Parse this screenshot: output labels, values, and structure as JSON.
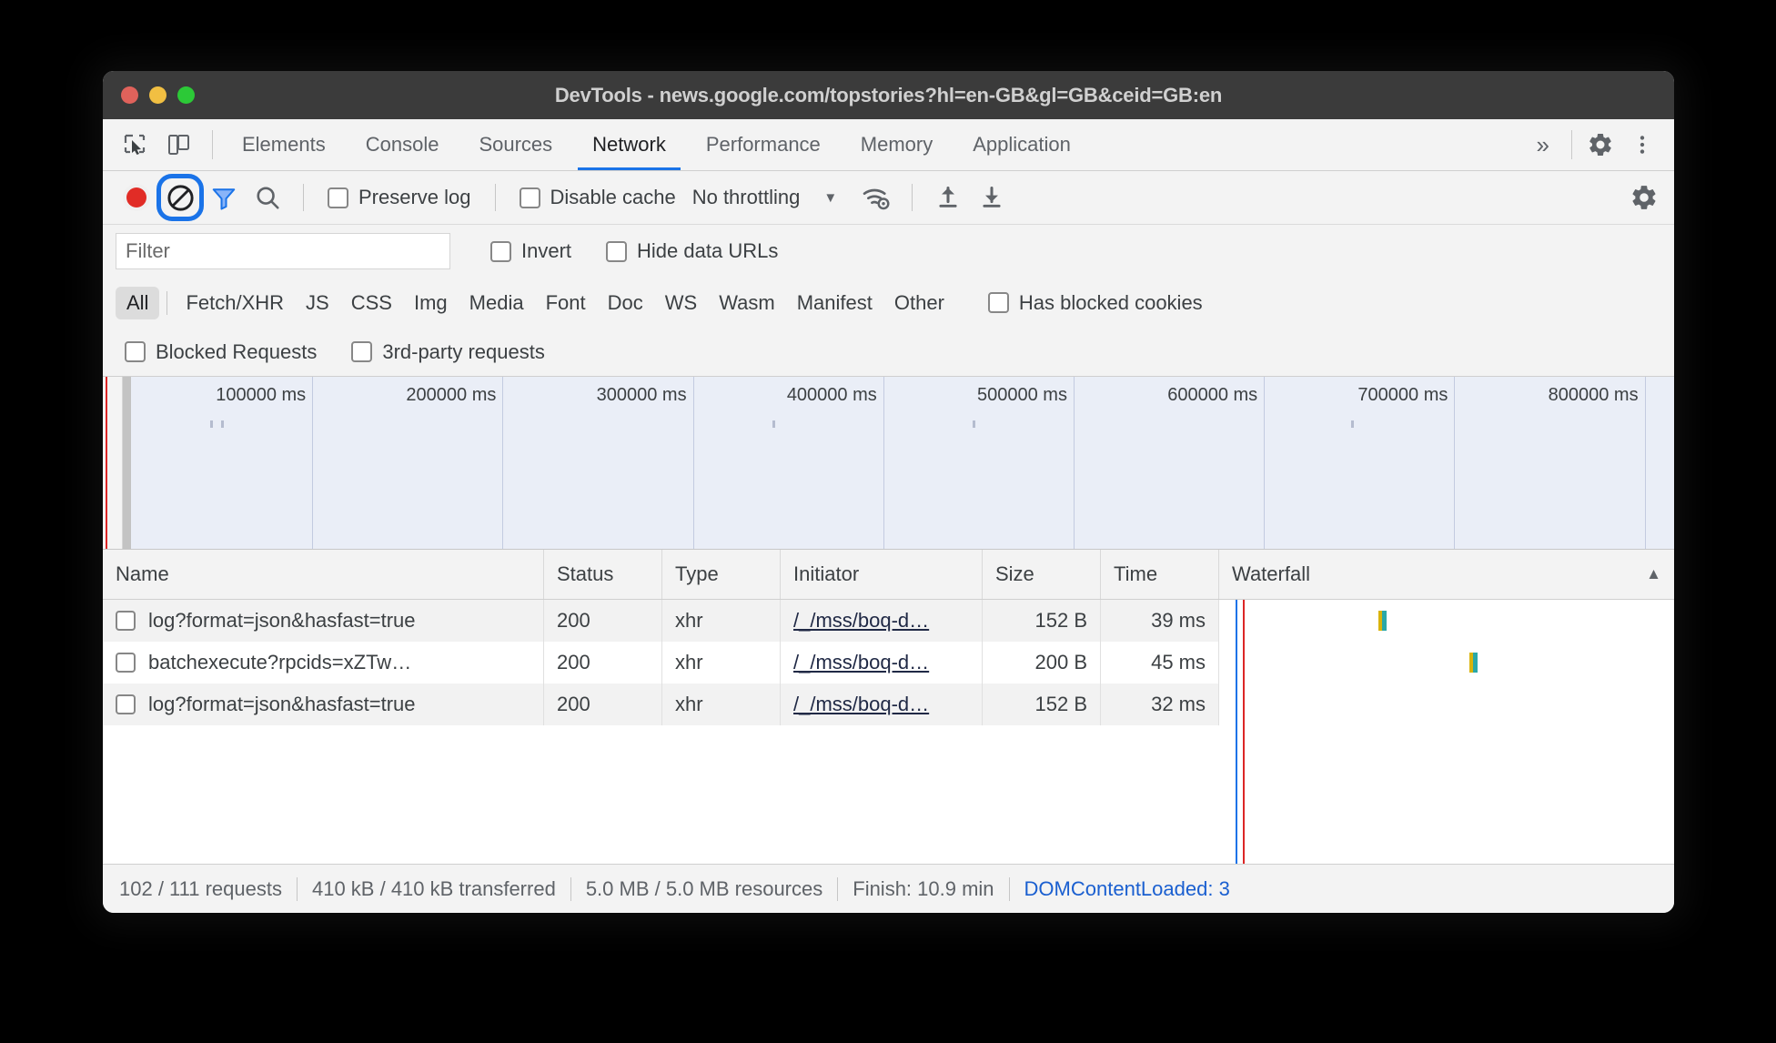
{
  "window": {
    "title": "DevTools - news.google.com/topstories?hl=en-GB&gl=GB&ceid=GB:en"
  },
  "tabstrip": {
    "tabs": [
      {
        "label": "Elements",
        "selected": false
      },
      {
        "label": "Console",
        "selected": false
      },
      {
        "label": "Sources",
        "selected": false
      },
      {
        "label": "Network",
        "selected": true
      },
      {
        "label": "Performance",
        "selected": false
      },
      {
        "label": "Memory",
        "selected": false
      },
      {
        "label": "Application",
        "selected": false
      }
    ],
    "more_label": "»",
    "inspect_icon": "inspect-element-icon",
    "device_icon": "device-toolbar-icon",
    "settings_icon": "gear-icon",
    "menu_icon": "kebab-menu-icon"
  },
  "toolbar": {
    "record_icon": "record-icon",
    "clear_icon": "clear-network-log-icon",
    "filter_icon": "filter-funnel-icon",
    "search_icon": "search-icon",
    "preserve_log_label": "Preserve log",
    "preserve_log_checked": false,
    "disable_cache_label": "Disable cache",
    "disable_cache_checked": false,
    "throttling_value": "No throttling",
    "throttling_caret": "▼",
    "wifi_icon": "network-conditions-icon",
    "import_icon": "import-har-icon",
    "export_icon": "export-har-icon",
    "settings_icon": "gear-icon"
  },
  "filter_bar": {
    "placeholder": "Filter",
    "value": "",
    "invert_label": "Invert",
    "invert_checked": false,
    "hide_data_urls_label": "Hide data URLs",
    "hide_data_urls_checked": false
  },
  "type_filters": {
    "items": [
      {
        "label": "All",
        "active": true
      },
      {
        "label": "Fetch/XHR",
        "active": false
      },
      {
        "label": "JS",
        "active": false
      },
      {
        "label": "CSS",
        "active": false
      },
      {
        "label": "Img",
        "active": false
      },
      {
        "label": "Media",
        "active": false
      },
      {
        "label": "Font",
        "active": false
      },
      {
        "label": "Doc",
        "active": false
      },
      {
        "label": "WS",
        "active": false
      },
      {
        "label": "Wasm",
        "active": false
      },
      {
        "label": "Manifest",
        "active": false
      },
      {
        "label": "Other",
        "active": false
      }
    ],
    "has_blocked_cookies_label": "Has blocked cookies",
    "has_blocked_cookies_checked": false,
    "blocked_requests_label": "Blocked Requests",
    "blocked_requests_checked": false,
    "third_party_label": "3rd-party requests",
    "third_party_checked": false
  },
  "overview": {
    "ticks": [
      "100000 ms",
      "200000 ms",
      "300000 ms",
      "400000 ms",
      "500000 ms",
      "600000 ms",
      "700000 ms",
      "800000 ms"
    ]
  },
  "table": {
    "columns": [
      {
        "label": "Name"
      },
      {
        "label": "Status"
      },
      {
        "label": "Type"
      },
      {
        "label": "Initiator"
      },
      {
        "label": "Size"
      },
      {
        "label": "Time"
      },
      {
        "label": "Waterfall",
        "sorted": true,
        "sort_arrow": "▲"
      }
    ],
    "rows": [
      {
        "name": "log?format=json&hasfast=true",
        "status": "200",
        "type": "xhr",
        "initiator": "/_/mss/boq-d…",
        "size": "152 B",
        "time": "39 ms"
      },
      {
        "name": "batchexecute?rpcids=xZTw…",
        "status": "200",
        "type": "xhr",
        "initiator": "/_/mss/boq-d…",
        "size": "200 B",
        "time": "45 ms"
      },
      {
        "name": "log?format=json&hasfast=true",
        "status": "200",
        "type": "xhr",
        "initiator": "/_/mss/boq-d…",
        "size": "152 B",
        "time": "32 ms"
      }
    ]
  },
  "statusbar": {
    "requests": "102 / 111 requests",
    "transferred": "410 kB / 410 kB transferred",
    "resources": "5.0 MB / 5.0 MB resources",
    "finish": "Finish: 10.9 min",
    "dom_content_loaded": "DOMContentLoaded: 3"
  },
  "colors": {
    "accent": "#1a73e8",
    "record_red": "#e12c26",
    "link_blue": "#1a5fd0",
    "waterfall_blue": "#1a73e8",
    "waterfall_red": "#dc2626",
    "waterfall_teal": "#2aa8a8",
    "waterfall_gold": "#d9b30a"
  }
}
